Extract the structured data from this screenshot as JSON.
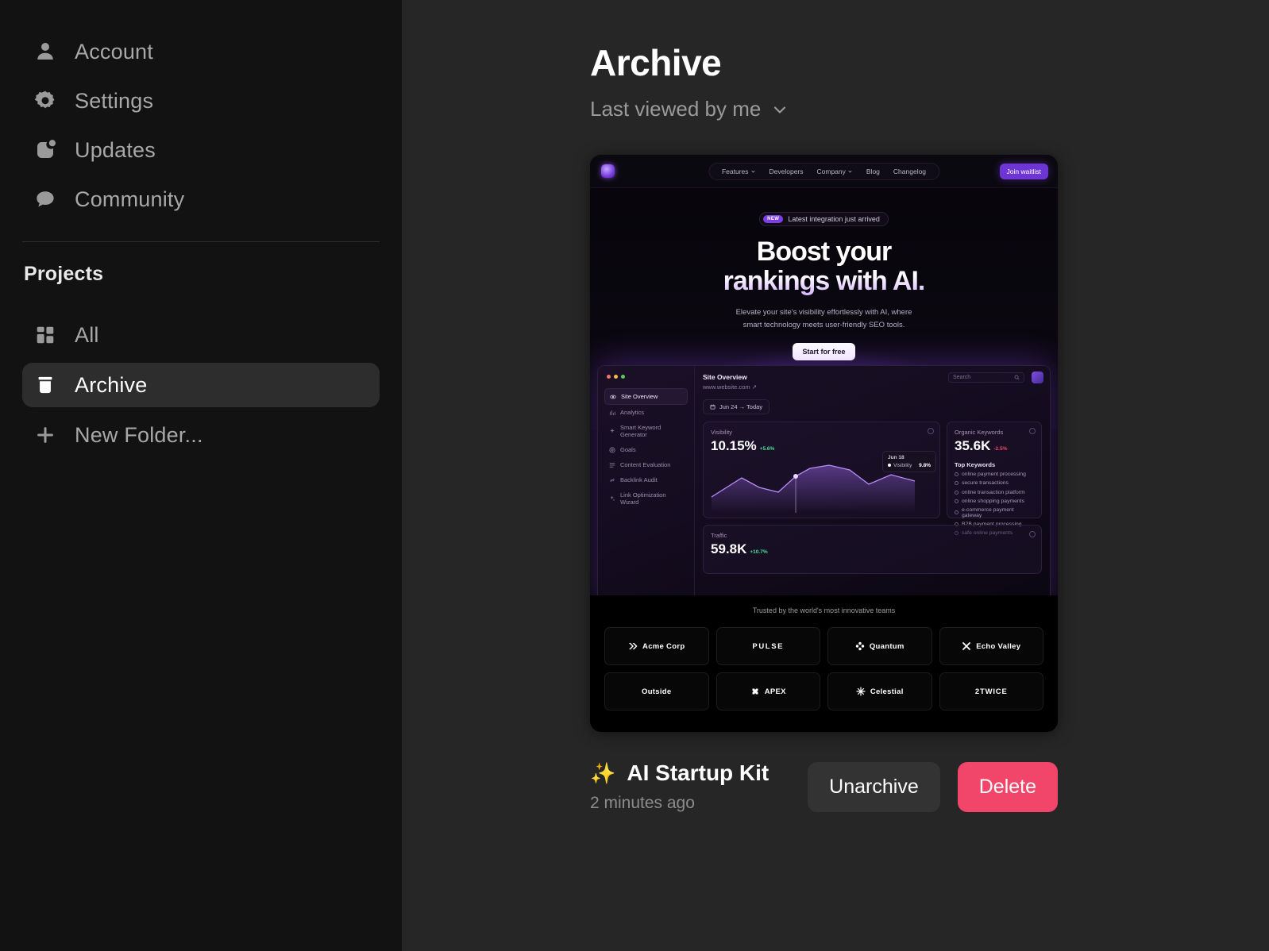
{
  "sidebar": {
    "nav": [
      {
        "label": "Account",
        "icon": "person-icon"
      },
      {
        "label": "Settings",
        "icon": "gear-icon"
      },
      {
        "label": "Updates",
        "icon": "updates-icon"
      },
      {
        "label": "Community",
        "icon": "chat-bubble-icon"
      }
    ],
    "section_title": "Projects",
    "projects": [
      {
        "label": "All",
        "icon": "grid-icon",
        "active": false
      },
      {
        "label": "Archive",
        "icon": "archive-box-icon",
        "active": true
      },
      {
        "label": "New Folder...",
        "icon": "plus-icon",
        "active": false
      }
    ]
  },
  "header": {
    "title": "Archive",
    "sort_label": "Last viewed by me",
    "sort_icon": "chevron-down-icon"
  },
  "card": {
    "title": "AI Startup Kit",
    "emoji": "✨",
    "timestamp": "2 minutes ago",
    "unarchive_label": "Unarchive",
    "delete_label": "Delete",
    "delete_color": "#f2456a",
    "unarchive_color": "#333333"
  },
  "preview": {
    "nav": {
      "links": [
        "Features",
        "Developers",
        "Company",
        "Blog",
        "Changelog"
      ],
      "cta": "Join waitlist",
      "cta_color": "#6d35d4"
    },
    "hero": {
      "badge_tag": "NEW",
      "badge_text": "Latest integration just arrived",
      "headline_line1": "Boost your",
      "headline_line2": "rankings with AI.",
      "subhead_line1": "Elevate your site's visibility effortlessly with AI, where",
      "subhead_line2": "smart technology meets user-friendly SEO tools.",
      "cta": "Start for free"
    },
    "dashboard": {
      "sidebar_items": [
        "Site Overview",
        "Analytics",
        "Smart Keyword Generator",
        "Goals",
        "Content Evaluation",
        "Backlink Audit",
        "Link Optimization Wizard"
      ],
      "active_item": "Site Overview",
      "title": "Site Overview",
      "url": "www.website.com",
      "search_placeholder": "Search",
      "date_range": "Jun 24 → Today",
      "visibility": {
        "label": "Visibility",
        "value": "10.15%",
        "delta": "+5.6%",
        "delta_dir": "up"
      },
      "tooltip": {
        "date": "Jun 18",
        "series": "Visibility",
        "value": "9.8%"
      },
      "organic": {
        "label": "Organic Keywords",
        "value": "35.6K",
        "delta": "-2.5%",
        "delta_dir": "down",
        "top_label": "Top Keywords",
        "keywords": [
          "online payment processing",
          "secure transactions",
          "online transaction platform",
          "online shopping payments",
          "e-commerce payment gateway",
          "B2B payment processing",
          "safe online payments"
        ]
      },
      "traffic": {
        "label": "Traffic",
        "value": "59.8K",
        "delta": "+10.7%",
        "delta_dir": "up"
      }
    },
    "trusted": {
      "heading": "Trusted by the world's most innovative teams",
      "logos": [
        {
          "name": "Acme Corp",
          "icon": "chevrons-right-icon"
        },
        {
          "name": "PULSE",
          "icon": "none"
        },
        {
          "name": "Quantum",
          "icon": "clover-icon"
        },
        {
          "name": "Echo Valley",
          "icon": "x-mark-icon"
        },
        {
          "name": "Outside",
          "icon": "none"
        },
        {
          "name": "APEX",
          "icon": "blob-icon"
        },
        {
          "name": "Celestial",
          "icon": "sparkle-star-icon"
        },
        {
          "name": "2TWICE",
          "icon": "none"
        }
      ]
    }
  }
}
